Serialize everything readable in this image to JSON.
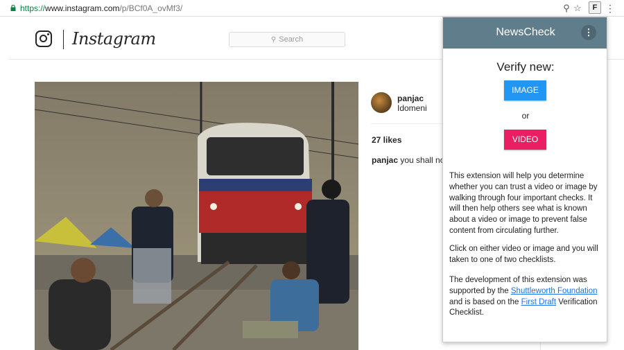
{
  "browser": {
    "url_scheme": "https://",
    "url_host": "www.instagram.com",
    "url_path": "/p/BCf0A_ovMf3/",
    "ext_badge": "F"
  },
  "instagram": {
    "wordmark": "Instagram",
    "search_placeholder": "Search"
  },
  "post": {
    "username": "panjac",
    "location": "Idomeni",
    "likes": "27 likes",
    "caption_user": "panjac",
    "caption_text": " you shall not"
  },
  "popup": {
    "title": "NewsCheck",
    "heading": "Verify new:",
    "image_button": "IMAGE",
    "or_text": "or",
    "video_button": "VIDEO",
    "para1": "This extension will help you determine whether you can trust a video or image by walking through four important checks. It will then help others see what is known about a video or image to prevent false content from circulating further.",
    "para2": "Click on either video or image and you will taken to one of two checklists.",
    "para3_a": "The development of this extension was supported by the ",
    "link1": "Shuttleworth Foundation",
    "para3_b": " and is based on the ",
    "link2": "First Draft",
    "para3_c": " Verification Checklist.",
    "colors": {
      "header": "#607d8b",
      "image_btn": "#2196f3",
      "video_btn": "#e91e63",
      "link": "#1a73e8"
    }
  },
  "icons": [
    "lock-icon",
    "key-icon",
    "star-icon",
    "extension-icon",
    "menu-icon",
    "instagram-glyph-icon",
    "search-icon",
    "more-vert-icon"
  ]
}
